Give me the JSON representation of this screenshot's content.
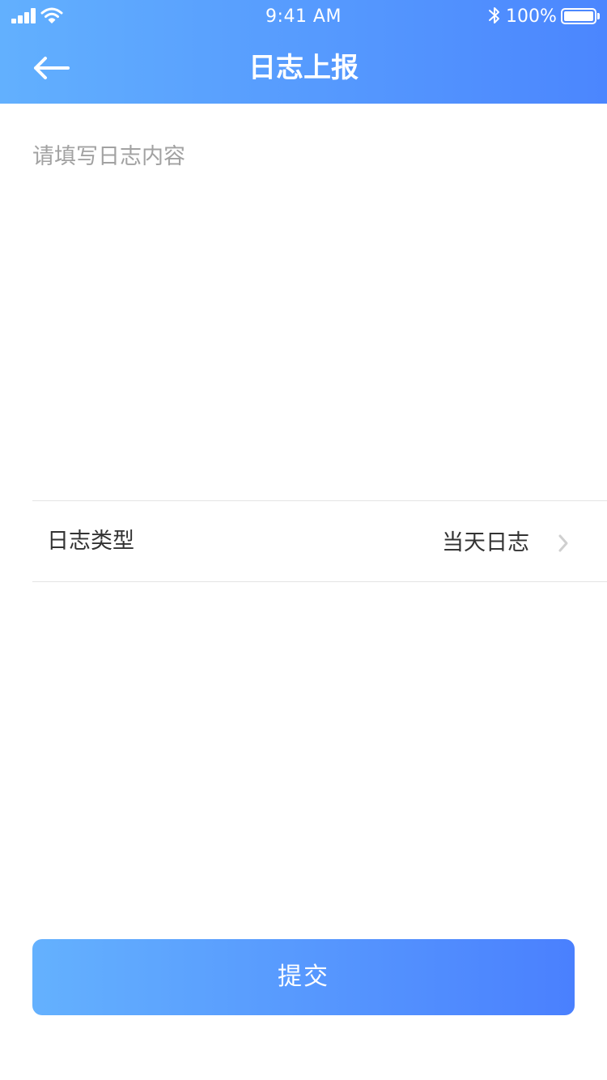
{
  "status_bar": {
    "time": "9:41 AM",
    "battery_percent": "100%",
    "icons": [
      "signal-icon",
      "wifi-icon",
      "bluetooth-icon",
      "battery-icon"
    ]
  },
  "nav": {
    "title": "日志上报",
    "back_icon": "arrow-left-icon"
  },
  "log_content": {
    "placeholder": "请填写日志内容",
    "value": ""
  },
  "log_type": {
    "label": "日志类型",
    "value": "当天日志",
    "icon": "chevron-right-icon"
  },
  "submit": {
    "label": "提交"
  },
  "colors": {
    "header_gradient_start": "#62b0fe",
    "header_gradient_end": "#4b86fe",
    "placeholder": "#a2a2a2",
    "text": "#333333",
    "divider": "#e4e4e4"
  }
}
